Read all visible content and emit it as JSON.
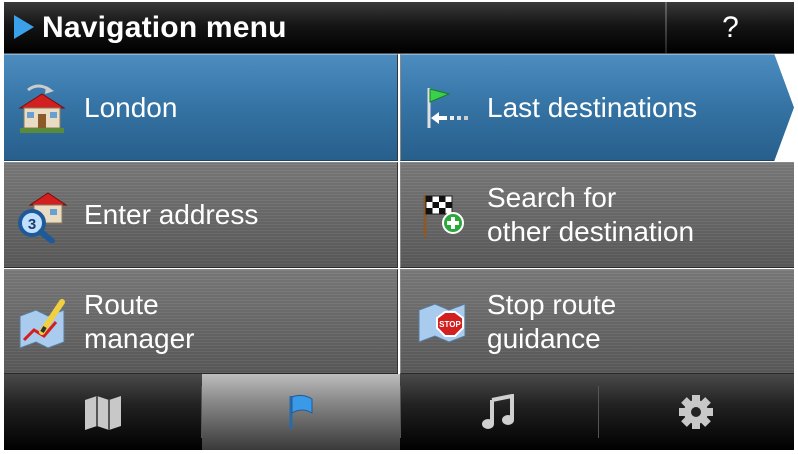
{
  "header": {
    "title": "Navigation menu",
    "help_label": "?"
  },
  "menu": {
    "items": [
      {
        "label_lines": [
          "London"
        ],
        "icon": "home-icon"
      },
      {
        "label_lines": [
          "Last destinations"
        ],
        "icon": "flag-history-icon"
      },
      {
        "label_lines": [
          "Enter address"
        ],
        "icon": "address-search-icon"
      },
      {
        "label_lines": [
          "Search for",
          "other destination"
        ],
        "icon": "checkered-flag-add-icon"
      },
      {
        "label_lines": [
          "Route",
          "manager"
        ],
        "icon": "route-map-pen-icon"
      },
      {
        "label_lines": [
          "Stop route",
          "guidance"
        ],
        "icon": "stop-sign-icon"
      }
    ]
  },
  "tabs": [
    {
      "name": "map",
      "icon": "map-icon"
    },
    {
      "name": "navigation",
      "icon": "flag-icon",
      "active": true
    },
    {
      "name": "music",
      "icon": "music-note-icon"
    },
    {
      "name": "settings",
      "icon": "gear-icon"
    }
  ],
  "colors": {
    "accent": "#3a7bb0",
    "title_arrow": "#3aa0ea",
    "tile": "#6a6a6a"
  }
}
